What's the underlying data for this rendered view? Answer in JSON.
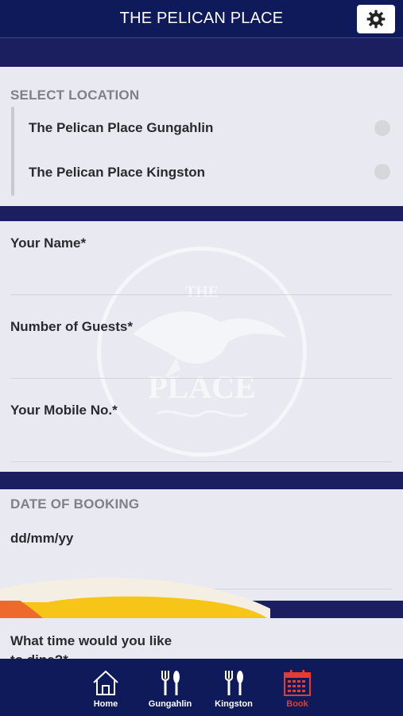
{
  "header": {
    "title": "THE PELICAN PLACE"
  },
  "location": {
    "label": "SELECT LOCATION",
    "options": [
      "The Pelican Place Gungahlin",
      "The Pelican Place Kingston"
    ]
  },
  "form": {
    "name_label": "Your Name*",
    "guests_label": "Number of Guests*",
    "mobile_label": "Your Mobile No.*",
    "date_section_label": "DATE OF BOOKING",
    "date_value": "dd/mm/yy",
    "time_label": "What time would you like to dine?*"
  },
  "watermark": {
    "text_top": "THE",
    "text_bottom": "PLACE"
  },
  "nav": {
    "items": [
      {
        "label": "Home",
        "icon": "home-icon"
      },
      {
        "label": "Gungahlin",
        "icon": "fork-knife-icon"
      },
      {
        "label": "Kingston",
        "icon": "fork-knife-icon"
      },
      {
        "label": "Book",
        "icon": "calendar-icon"
      }
    ],
    "active": "Book",
    "active_color": "#e63b2e"
  },
  "colors": {
    "header_bg": "#0e1a5a",
    "band": "#1c1f5f",
    "panel": "#e9eaf1"
  }
}
